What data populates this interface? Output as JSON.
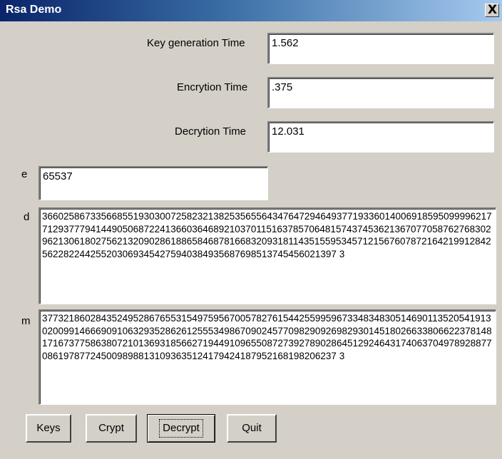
{
  "window": {
    "title": "Rsa Demo",
    "close_glyph": "X"
  },
  "labels": {
    "keygen": "Key generation Time",
    "encrypt": "Encrytion Time",
    "decrypt": "Decrytion Time",
    "e": "e",
    "d": "d",
    "m": "m"
  },
  "fields": {
    "keygen_time": "1.562",
    "encrypt_time": ".375",
    "decrypt_time": "12.031",
    "e": "65537",
    "d": "3660258673356685519303007258232138253565564347647294649377193360140069185950999962177129377794144905068722413660364689210370115163785706481574374536213670770587627683029621306180275621320902861886584687816683209318114351559534571215676078721642199128425622822442552030693454275940384935687698513745456021397 3",
    "m": "3773218602843524952867655315497595670057827615442559959673348348305146901135205419130200991466690910632935286261255534986709024577098290926982930145180266338066223781481716737758638072101369318566271944910965508727392789028645129246431740637049789288770861978772450098988131093635124179424187952168198206237 3"
  },
  "buttons": {
    "keys": "Keys",
    "crypt": "Crypt",
    "decrypt": "Decrypt",
    "quit": "Quit"
  }
}
